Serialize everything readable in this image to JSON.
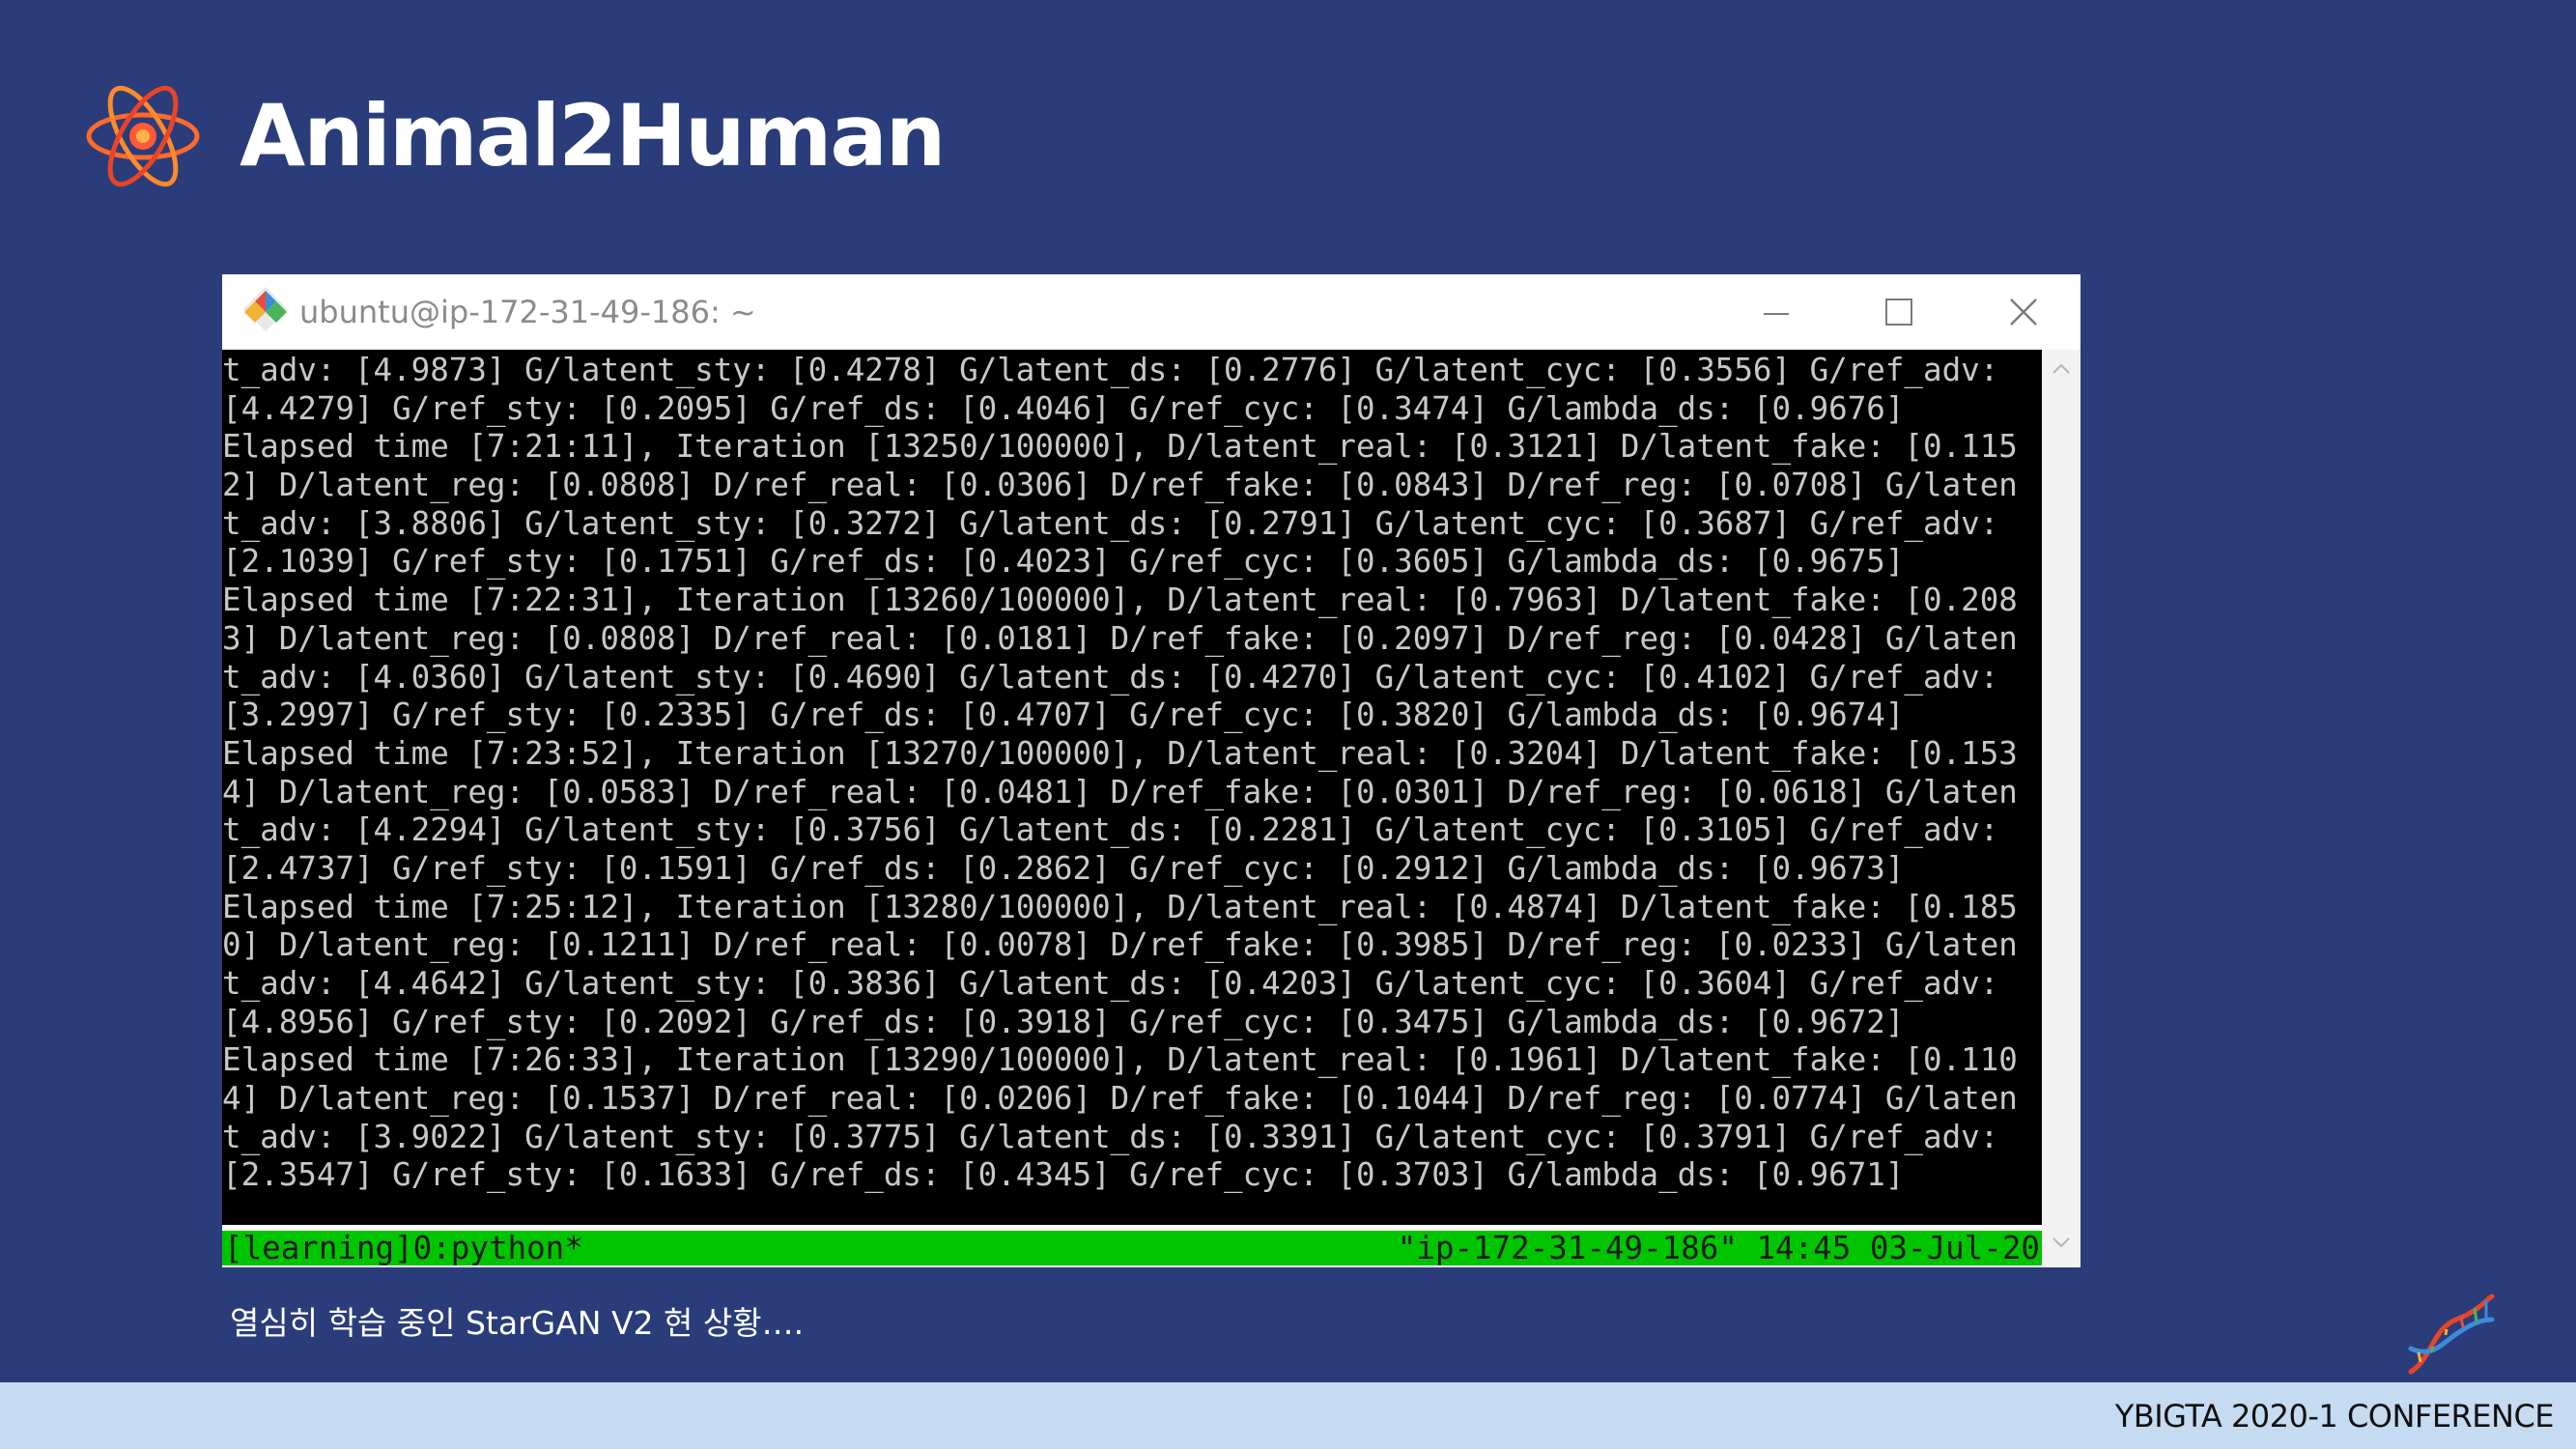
{
  "slide": {
    "title": "Animal2Human",
    "caption": "열심히 학습 중인 StarGAN V2 현 상황….",
    "footer": "YBIGTA 2020-1 CONFERENCE"
  },
  "window": {
    "title": "ubuntu@ip-172-31-49-186: ~",
    "icons": {
      "app": "git-diamond-icon",
      "minimize": "minimize-icon",
      "maximize": "maximize-icon",
      "close": "close-icon"
    }
  },
  "terminal": {
    "lines": [
      "t_adv: [4.9873] G/latent_sty: [0.4278] G/latent_ds: [0.2776] G/latent_cyc: [0.3556] G/ref_adv:",
      "[4.4279] G/ref_sty: [0.2095] G/ref_ds: [0.4046] G/ref_cyc: [0.3474] G/lambda_ds: [0.9676]",
      "Elapsed time [7:21:11], Iteration [13250/100000], D/latent_real: [0.3121] D/latent_fake: [0.115",
      "2] D/latent_reg: [0.0808] D/ref_real: [0.0306] D/ref_fake: [0.0843] D/ref_reg: [0.0708] G/laten",
      "t_adv: [3.8806] G/latent_sty: [0.3272] G/latent_ds: [0.2791] G/latent_cyc: [0.3687] G/ref_adv:",
      "[2.1039] G/ref_sty: [0.1751] G/ref_ds: [0.4023] G/ref_cyc: [0.3605] G/lambda_ds: [0.9675]",
      "Elapsed time [7:22:31], Iteration [13260/100000], D/latent_real: [0.7963] D/latent_fake: [0.208",
      "3] D/latent_reg: [0.0808] D/ref_real: [0.0181] D/ref_fake: [0.2097] D/ref_reg: [0.0428] G/laten",
      "t_adv: [4.0360] G/latent_sty: [0.4690] G/latent_ds: [0.4270] G/latent_cyc: [0.4102] G/ref_adv:",
      "[3.2997] G/ref_sty: [0.2335] G/ref_ds: [0.4707] G/ref_cyc: [0.3820] G/lambda_ds: [0.9674]",
      "Elapsed time [7:23:52], Iteration [13270/100000], D/latent_real: [0.3204] D/latent_fake: [0.153",
      "4] D/latent_reg: [0.0583] D/ref_real: [0.0481] D/ref_fake: [0.0301] D/ref_reg: [0.0618] G/laten",
      "t_adv: [4.2294] G/latent_sty: [0.3756] G/latent_ds: [0.2281] G/latent_cyc: [0.3105] G/ref_adv:",
      "[2.4737] G/ref_sty: [0.1591] G/ref_ds: [0.2862] G/ref_cyc: [0.2912] G/lambda_ds: [0.9673]",
      "Elapsed time [7:25:12], Iteration [13280/100000], D/latent_real: [0.4874] D/latent_fake: [0.185",
      "0] D/latent_reg: [0.1211] D/ref_real: [0.0078] D/ref_fake: [0.3985] D/ref_reg: [0.0233] G/laten",
      "t_adv: [4.4642] G/latent_sty: [0.3836] G/latent_ds: [0.4203] G/latent_cyc: [0.3604] G/ref_adv:",
      "[4.8956] G/ref_sty: [0.2092] G/ref_ds: [0.3918] G/ref_cyc: [0.3475] G/lambda_ds: [0.9672]",
      "Elapsed time [7:26:33], Iteration [13290/100000], D/latent_real: [0.1961] D/latent_fake: [0.110",
      "4] D/latent_reg: [0.1537] D/ref_real: [0.0206] D/ref_fake: [0.1044] D/ref_reg: [0.0774] G/laten",
      "t_adv: [3.9022] G/latent_sty: [0.3775] G/latent_ds: [0.3391] G/latent_cyc: [0.3791] G/ref_adv:",
      "[2.3547] G/ref_sty: [0.1633] G/ref_ds: [0.4345] G/ref_cyc: [0.3703] G/lambda_ds: [0.9671]"
    ],
    "status_left": "[learning]0:python*",
    "status_right": "\"ip-172-31-49-186\" 14:45 03-Jul-20"
  },
  "colors": {
    "background": "#2a3d7a",
    "footer_band": "#c5dbf2",
    "terminal_bg": "#000000",
    "terminal_text": "#c8c8c8",
    "tmux_status": "#00c400"
  },
  "decor": {
    "logo": "atom-icon",
    "corner": "dna-helix-icon"
  }
}
